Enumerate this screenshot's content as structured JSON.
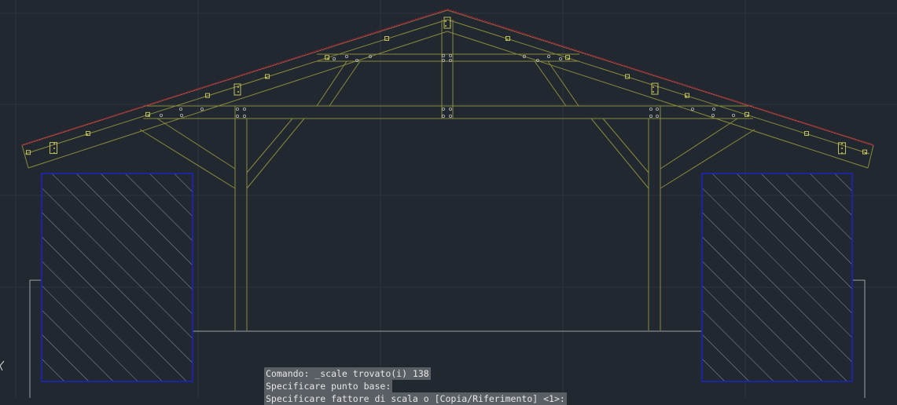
{
  "colors": {
    "background": "#212830",
    "grid": "#2b333d",
    "truss": "#8a8a3c",
    "roof_tiles": "#a0203a",
    "hatch_outline": "#1a22c8",
    "hatch_lines": "#8a94a4",
    "ground_line": "#9ea2a8",
    "command_bg": "#5e6268",
    "command_text": "#e6e6e6"
  },
  "icons": {
    "ucs_marker": "ucs-axis-icon"
  },
  "command_line": {
    "history": [
      "Comando: _scale trovato(i) 138",
      "Specificare punto base:",
      "Specificare fattore di scala o [Copia/Riferimento] <1>:"
    ]
  }
}
